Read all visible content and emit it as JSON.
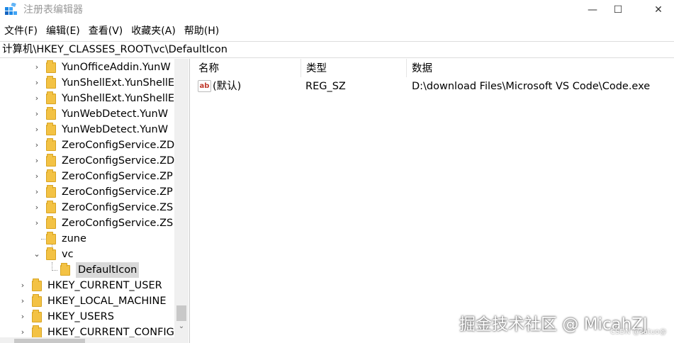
{
  "window": {
    "title": "注册表编辑器",
    "minimize_glyph": "—",
    "maximize_glyph": "☐",
    "close_glyph": "✕"
  },
  "menu": [
    "文件(F)",
    "编辑(E)",
    "查看(V)",
    "收藏夹(A)",
    "帮助(H)"
  ],
  "address": "计算机\\HKEY_CLASSES_ROOT\\vc\\DefaultIcon",
  "tree": [
    {
      "label": "YunOfficeAddin.YunW",
      "expander": "›"
    },
    {
      "label": "YunShellExt.YunShellE",
      "expander": "›"
    },
    {
      "label": "YunShellExt.YunShellE",
      "expander": "›"
    },
    {
      "label": "YunWebDetect.YunW",
      "expander": "›"
    },
    {
      "label": "YunWebDetect.YunW",
      "expander": "›"
    },
    {
      "label": "ZeroConfigService.ZD",
      "expander": "›"
    },
    {
      "label": "ZeroConfigService.ZD",
      "expander": "›"
    },
    {
      "label": "ZeroConfigService.ZP",
      "expander": "›"
    },
    {
      "label": "ZeroConfigService.ZP",
      "expander": "›"
    },
    {
      "label": "ZeroConfigService.ZS",
      "expander": "›"
    },
    {
      "label": "ZeroConfigService.ZS",
      "expander": "›"
    },
    {
      "label": "zune",
      "expander": ""
    },
    {
      "label": "vc",
      "expander": "⌄"
    },
    {
      "label": "DefaultIcon",
      "expander": "",
      "selected": true
    },
    {
      "label": "HKEY_CURRENT_USER",
      "expander": "›"
    },
    {
      "label": "HKEY_LOCAL_MACHINE",
      "expander": "›"
    },
    {
      "label": "HKEY_USERS",
      "expander": "›"
    },
    {
      "label": "HKEY_CURRENT_CONFIG",
      "expander": "›"
    }
  ],
  "list": {
    "columns": [
      "名称",
      "类型",
      "数据"
    ],
    "rows": [
      {
        "icon": "string-value-icon",
        "icon_text": "ab",
        "name": "(默认)",
        "type": "REG_SZ",
        "data": "D:\\download Files\\Microsoft VS Code\\Code.exe"
      }
    ]
  },
  "watermark": {
    "main": "掘金技术社区 @ MicahZJ",
    "small": "CSDN @satuo@"
  },
  "colors": {
    "folder": "#f3c244",
    "selection": "#d9d9d9"
  }
}
